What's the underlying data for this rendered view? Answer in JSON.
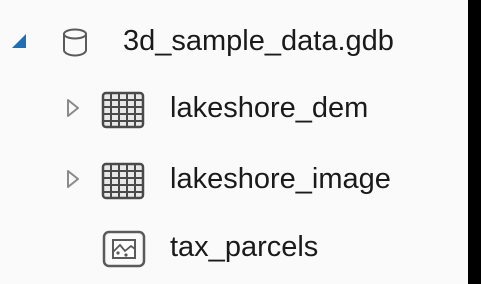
{
  "tree": {
    "items": [
      {
        "label": "3d_sample_data.gdb",
        "icon": "geodatabase-icon",
        "expander": "expanded-triangle-icon",
        "expanded": true
      },
      {
        "label": "lakeshore_dem",
        "icon": "raster-dataset-icon",
        "expander": "collapsed-triangle-icon",
        "expanded": false
      },
      {
        "label": "lakeshore_image",
        "icon": "raster-dataset-icon",
        "expander": "collapsed-triangle-icon",
        "expanded": false
      },
      {
        "label": "tax_parcels",
        "icon": "polygon-feature-class-icon"
      }
    ]
  },
  "colors": {
    "panel_background": "#fafafa",
    "frame_border": "#000000",
    "text": "#1a1a1a",
    "expanded_arrow": "#1f6fb5",
    "collapsed_arrow": "#8a8a8a",
    "icon_stroke": "#5a5a5a"
  }
}
